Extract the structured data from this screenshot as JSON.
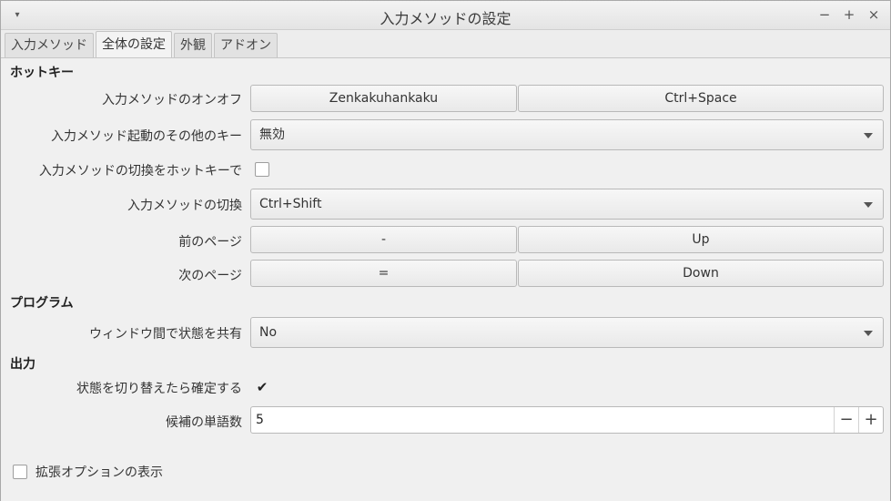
{
  "window": {
    "title": "入力メソッドの設定",
    "menu_icon": "▾",
    "minimize": "−",
    "maximize": "+",
    "close": "×"
  },
  "tabs": [
    {
      "label": "入力メソッド",
      "active": false
    },
    {
      "label": "全体の設定",
      "active": true
    },
    {
      "label": "外観",
      "active": false
    },
    {
      "label": "アドオン",
      "active": false
    }
  ],
  "hotkey": {
    "section_title": "ホットキー",
    "toggle_label": "入力メソッドのオンオフ",
    "toggle_key1": "Zenkakuhankaku",
    "toggle_key2": "Ctrl+Space",
    "extra_trigger_label": "入力メソッド起動のその他のキー",
    "extra_trigger_value": "無効",
    "switch_with_hotkey_label": "入力メソッドの切換をホットキーで",
    "switch_with_hotkey_checked": false,
    "switch_label": "入力メソッドの切換",
    "switch_value": "Ctrl+Shift",
    "prev_page_label": "前のページ",
    "prev_page_key1": "-",
    "prev_page_key2": "Up",
    "next_page_label": "次のページ",
    "next_page_key1": "=",
    "next_page_key2": "Down"
  },
  "program": {
    "section_title": "プログラム",
    "share_state_label": "ウィンドウ間で状態を共有",
    "share_state_value": "No"
  },
  "output": {
    "section_title": "出力",
    "commit_on_switch_label": "状態を切り替えたら確定する",
    "commit_on_switch_checked": true,
    "candidate_count_label": "候補の単語数",
    "candidate_count_value": "5",
    "decrement": "−",
    "increment": "+"
  },
  "advanced": {
    "label": "拡張オプションの表示",
    "checked": false
  },
  "icons": {
    "check": "✔"
  }
}
